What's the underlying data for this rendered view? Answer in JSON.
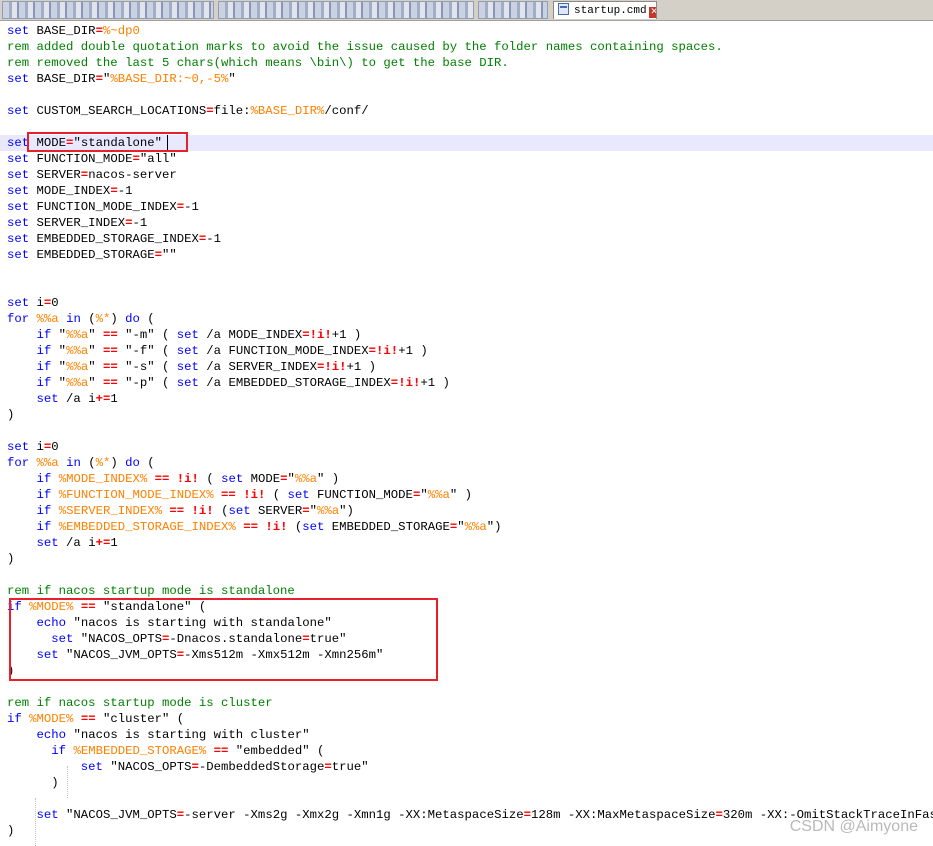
{
  "tabs": {
    "active_label": "startup.cmd",
    "active_close": "✕",
    "blurred_count": 3
  },
  "code_lines": [
    "set BASE_DIR=%~dp0",
    "rem added double quotation marks to avoid the issue caused by the folder names containing spaces.",
    "rem removed the last 5 chars(which means \\bin\\) to get the base DIR.",
    "set BASE_DIR=\"%BASE_DIR:~0,-5%\"",
    "",
    "set CUSTOM_SEARCH_LOCATIONS=file:%BASE_DIR%/conf/",
    "",
    "set MODE=\"standalone\"",
    "set FUNCTION_MODE=\"all\"",
    "set SERVER=nacos-server",
    "set MODE_INDEX=-1",
    "set FUNCTION_MODE_INDEX=-1",
    "set SERVER_INDEX=-1",
    "set EMBEDDED_STORAGE_INDEX=-1",
    "set EMBEDDED_STORAGE=\"\"",
    "",
    "",
    "set i=0",
    "for %%a in (%*) do (",
    "    if \"%%a\" == \"-m\" ( set /a MODE_INDEX=!i!+1 )",
    "    if \"%%a\" == \"-f\" ( set /a FUNCTION_MODE_INDEX=!i!+1 )",
    "    if \"%%a\" == \"-s\" ( set /a SERVER_INDEX=!i!+1 )",
    "    if \"%%a\" == \"-p\" ( set /a EMBEDDED_STORAGE_INDEX=!i!+1 )",
    "    set /a i+=1",
    ")",
    "",
    "set i=0",
    "for %%a in (%*) do (",
    "    if %MODE_INDEX% == !i! ( set MODE=\"%%a\" )",
    "    if %FUNCTION_MODE_INDEX% == !i! ( set FUNCTION_MODE=\"%%a\" )",
    "    if %SERVER_INDEX% == !i! (set SERVER=\"%%a\")",
    "    if %EMBEDDED_STORAGE_INDEX% == !i! (set EMBEDDED_STORAGE=\"%%a\")",
    "    set /a i+=1",
    ")",
    "",
    "rem if nacos startup mode is standalone",
    "if %MODE% == \"standalone\" (",
    "    echo \"nacos is starting with standalone\"",
    "      set \"NACOS_OPTS=-Dnacos.standalone=true\"",
    "    set \"NACOS_JVM_OPTS=-Xms512m -Xmx512m -Xmn256m\"",
    ")",
    "",
    "rem if nacos startup mode is cluster",
    "if %MODE% == \"cluster\" (",
    "    echo \"nacos is starting with cluster\"",
    "      if %EMBEDDED_STORAGE% == \"embedded\" (",
    "          set \"NACOS_OPTS=-DembeddedStorage=true\"",
    "      )",
    "",
    "    set \"NACOS_JVM_OPTS=-server -Xms2g -Xmx2g -Xmn1g -XX:MetaspaceSize=128m -XX:MaxMetaspaceSize=320m -XX:-OmitStackTraceInFastThrow\"",
    ")"
  ],
  "current_line_index": 7,
  "watermark": "CSDN @Aimyone",
  "colors": {
    "keyword": "#0000ff",
    "comment": "#008000",
    "variable": "#ff8000",
    "operator": "#ff0000",
    "current_line": "#e8e8ff",
    "annotation_box": "#e8202a"
  }
}
